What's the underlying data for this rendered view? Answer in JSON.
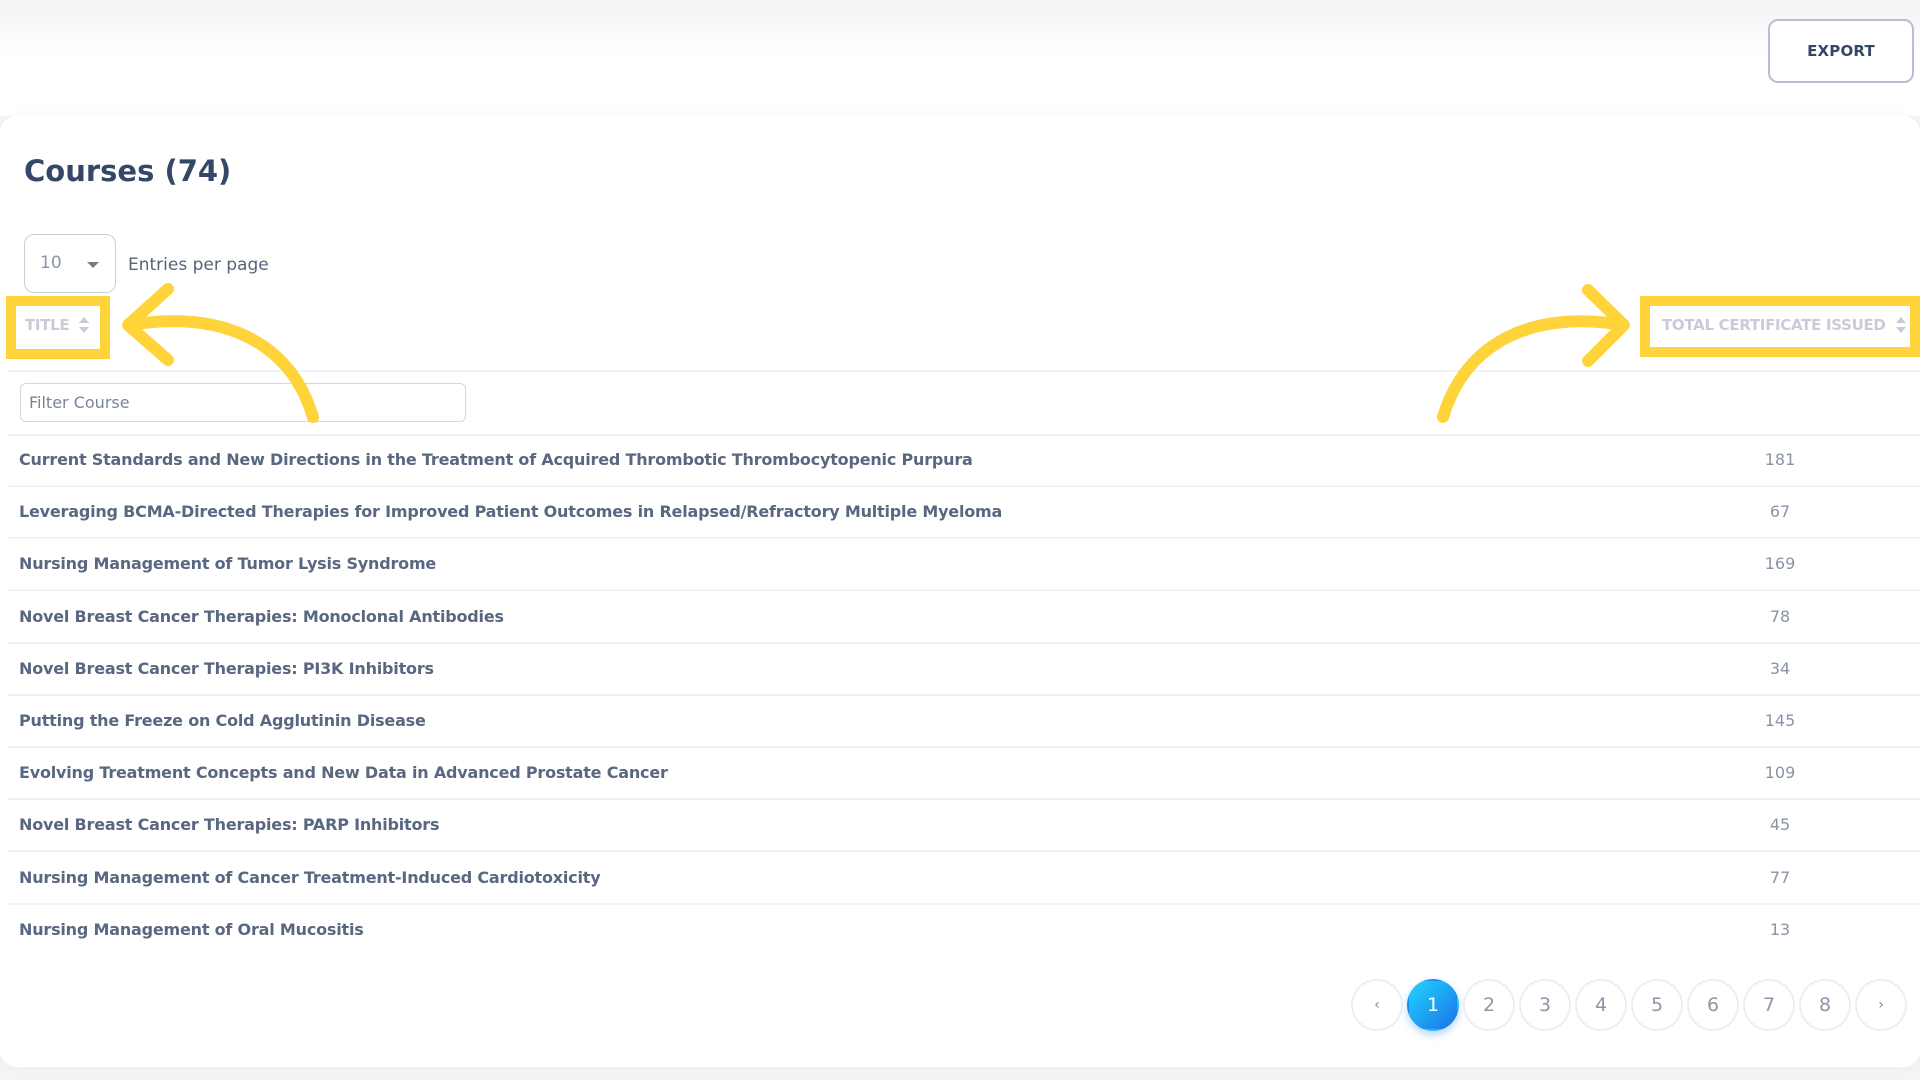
{
  "toolbar": {
    "export_label": "EXPORT"
  },
  "page": {
    "title": "Courses (74)",
    "entries_per_page": {
      "value": "10",
      "label": "Entries per page"
    }
  },
  "table": {
    "columns": [
      {
        "label": "TITLE",
        "sortable": true
      },
      {
        "label": "TOTAL CERTIFICATE ISSUED",
        "sortable": true
      }
    ],
    "filter": {
      "placeholder": "Filter Course",
      "value": ""
    },
    "rows": [
      {
        "title": "Current Standards and New Directions in the Treatment of Acquired Thrombotic Thrombocytopenic Purpura",
        "certificates": "181"
      },
      {
        "title": "Leveraging BCMA-Directed Therapies for Improved Patient Outcomes in Relapsed/Refractory Multiple Myeloma",
        "certificates": "67"
      },
      {
        "title": "Nursing Management of Tumor Lysis Syndrome",
        "certificates": "169"
      },
      {
        "title": "Novel Breast Cancer Therapies: Monoclonal Antibodies",
        "certificates": "78"
      },
      {
        "title": "Novel Breast Cancer Therapies: PI3K Inhibitors",
        "certificates": "34"
      },
      {
        "title": "Putting the Freeze on Cold Agglutinin Disease",
        "certificates": "145"
      },
      {
        "title": "Evolving Treatment Concepts and New Data in Advanced Prostate Cancer",
        "certificates": "109"
      },
      {
        "title": "Novel Breast Cancer Therapies: PARP Inhibitors",
        "certificates": "45"
      },
      {
        "title": "Nursing Management of Cancer Treatment-Induced Cardiotoxicity",
        "certificates": "77"
      },
      {
        "title": "Nursing Management of Oral Mucositis",
        "certificates": "13"
      }
    ]
  },
  "pagination": {
    "prev_label": "‹",
    "next_label": "›",
    "current": "1",
    "pages": [
      "1",
      "2",
      "3",
      "4",
      "5",
      "6",
      "7",
      "8"
    ]
  },
  "annotations": {
    "highlight_color": "#ffd43b",
    "highlighted": [
      "TITLE",
      "TOTAL CERTIFICATE ISSUED"
    ]
  },
  "colors": {
    "accent_gradient_start": "#21d4fd",
    "accent_gradient_end": "#1a73e8",
    "heading_text": "#344767"
  }
}
